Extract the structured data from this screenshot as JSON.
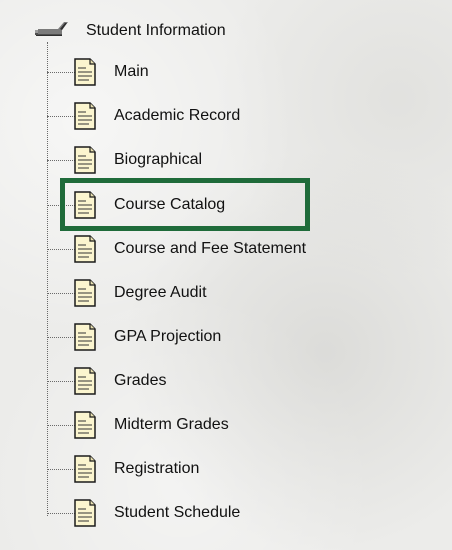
{
  "tree": {
    "root_label": "Student Information",
    "items": [
      {
        "label": "Main"
      },
      {
        "label": "Academic Record"
      },
      {
        "label": "Biographical"
      },
      {
        "label": "Course Catalog"
      },
      {
        "label": "Course and Fee Statement"
      },
      {
        "label": "Degree Audit"
      },
      {
        "label": "GPA Projection"
      },
      {
        "label": "Grades"
      },
      {
        "label": "Midterm Grades"
      },
      {
        "label": "Registration"
      },
      {
        "label": "Student Schedule"
      }
    ],
    "highlighted_item": "Course Catalog"
  },
  "colors": {
    "highlight_border": "#1f6b3a",
    "connector": "#6a6a6a",
    "background": "#ececea"
  },
  "icons": {
    "root": "folder-tree-icon",
    "item": "document-icon"
  }
}
